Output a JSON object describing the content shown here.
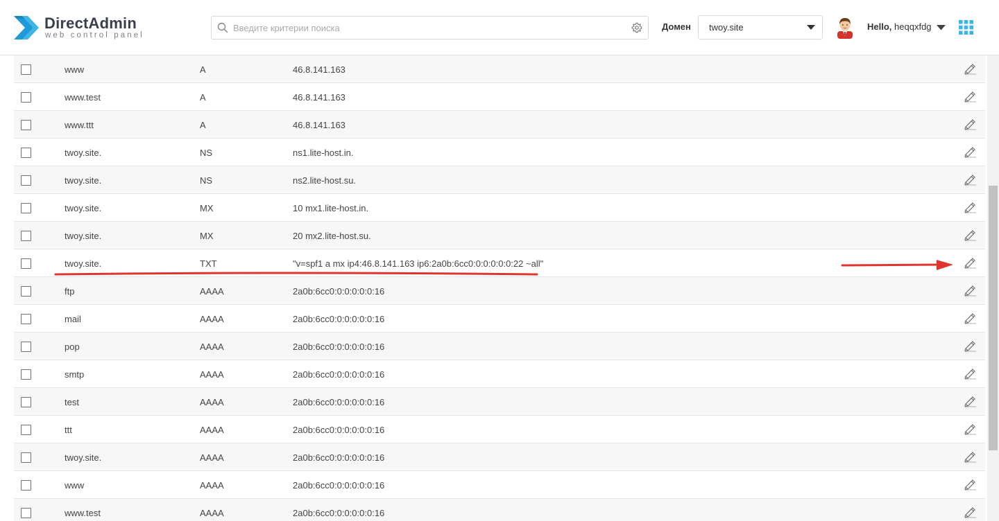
{
  "header": {
    "logo": {
      "title": "DirectAdmin",
      "subtitle": "web control panel"
    },
    "search": {
      "placeholder": "Введите критерии поиска",
      "value": ""
    },
    "domain": {
      "label": "Домен",
      "selected": "twoy.site"
    },
    "user": {
      "greeting": "Hello,",
      "username": "heqqxfdg"
    }
  },
  "colors": {
    "accent": "#1e9bd7",
    "annotation": "#e0342f"
  },
  "records": [
    {
      "name": "www",
      "type": "A",
      "value": "46.8.141.163"
    },
    {
      "name": "www.test",
      "type": "A",
      "value": "46.8.141.163"
    },
    {
      "name": "www.ttt",
      "type": "A",
      "value": "46.8.141.163"
    },
    {
      "name": "twoy.site.",
      "type": "NS",
      "value": "ns1.lite-host.in."
    },
    {
      "name": "twoy.site.",
      "type": "NS",
      "value": "ns2.lite-host.su."
    },
    {
      "name": "twoy.site.",
      "type": "MX",
      "value": "10 mx1.lite-host.in."
    },
    {
      "name": "twoy.site.",
      "type": "MX",
      "value": "20 mx2.lite-host.su."
    },
    {
      "name": "twoy.site.",
      "type": "TXT",
      "value": "\"v=spf1 a mx ip4:46.8.141.163 ip6:2a0b:6cc0:0:0:0:0:0:22 ~all\""
    },
    {
      "name": "ftp",
      "type": "AAAA",
      "value": "2a0b:6cc0:0:0:0:0:0:16"
    },
    {
      "name": "mail",
      "type": "AAAA",
      "value": "2a0b:6cc0:0:0:0:0:0:16"
    },
    {
      "name": "pop",
      "type": "AAAA",
      "value": "2a0b:6cc0:0:0:0:0:0:16"
    },
    {
      "name": "smtp",
      "type": "AAAA",
      "value": "2a0b:6cc0:0:0:0:0:0:16"
    },
    {
      "name": "test",
      "type": "AAAA",
      "value": "2a0b:6cc0:0:0:0:0:0:16"
    },
    {
      "name": "ttt",
      "type": "AAAA",
      "value": "2a0b:6cc0:0:0:0:0:0:16"
    },
    {
      "name": "twoy.site.",
      "type": "AAAA",
      "value": "2a0b:6cc0:0:0:0:0:0:16"
    },
    {
      "name": "www",
      "type": "AAAA",
      "value": "2a0b:6cc0:0:0:0:0:0:16"
    },
    {
      "name": "www.test",
      "type": "AAAA",
      "value": "2a0b:6cc0:0:0:0:0:0:16"
    }
  ]
}
